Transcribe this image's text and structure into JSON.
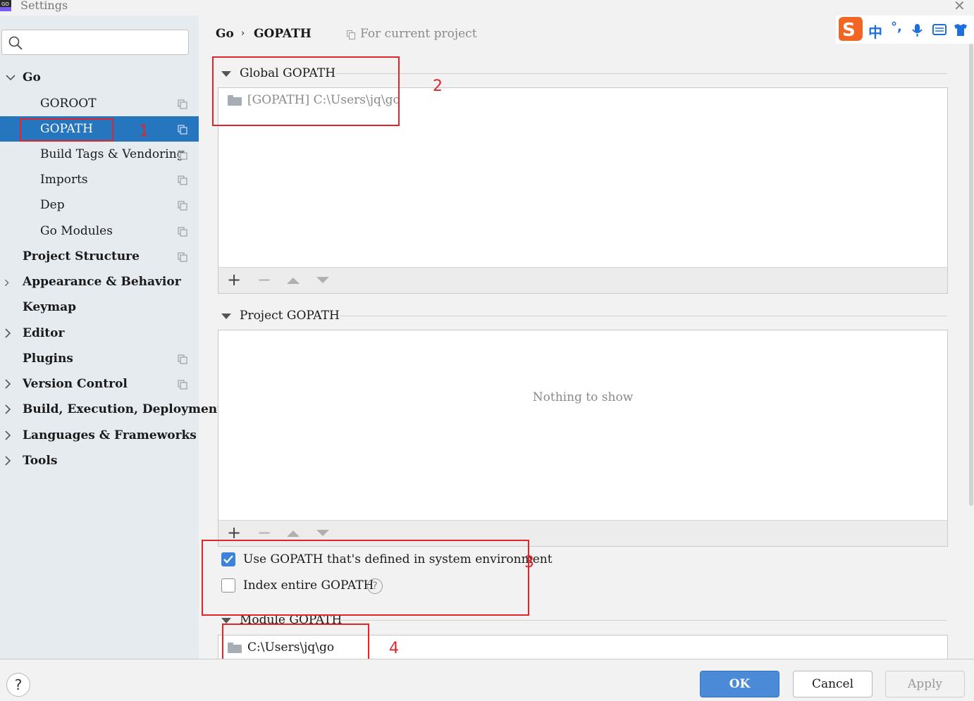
{
  "window": {
    "title": "Settings",
    "close_icon": "close-icon",
    "app_icon": "goland-app-icon"
  },
  "search": {
    "placeholder": "",
    "icon": "search-icon"
  },
  "sidebar": {
    "items": [
      {
        "label": "Go",
        "expanded": true
      },
      {
        "label": "GOROOT"
      },
      {
        "label": "GOPATH",
        "selected": true
      },
      {
        "label": "Build Tags & Vendoring"
      },
      {
        "label": "Imports"
      },
      {
        "label": "Dep"
      },
      {
        "label": "Go Modules"
      },
      {
        "label": "Project Structure"
      },
      {
        "label": "Appearance & Behavior",
        "expandable": true
      },
      {
        "label": "Keymap"
      },
      {
        "label": "Editor",
        "expandable": true
      },
      {
        "label": "Plugins"
      },
      {
        "label": "Version Control",
        "expandable": true
      },
      {
        "label": "Build, Execution, Deployment",
        "expandable": true
      },
      {
        "label": "Languages & Frameworks",
        "expandable": true
      },
      {
        "label": "Tools",
        "expandable": true
      }
    ]
  },
  "breadcrumb": {
    "parent": "Go",
    "separator": "›",
    "current": "GOPATH",
    "scope": "For current project"
  },
  "global_gopath": {
    "title": "Global GOPATH",
    "entries": [
      "[GOPATH] C:\\Users\\jq\\go"
    ]
  },
  "project_gopath": {
    "title": "Project GOPATH",
    "empty_text": "Nothing to show"
  },
  "toolbar": {
    "add": "+",
    "remove": "−"
  },
  "options": {
    "use_system_env": {
      "label": "Use GOPATH that's defined in system environment",
      "checked": true
    },
    "index_entire": {
      "label": "Index entire GOPATH",
      "checked": false,
      "help": "?"
    }
  },
  "module_gopath": {
    "title": "Module GOPATH",
    "entries": [
      "C:\\Users\\jq\\go"
    ]
  },
  "annotations": [
    "1",
    "2",
    "3",
    "4"
  ],
  "ime": {
    "label": "中",
    "punct": "°,",
    "icons": [
      "sogou-logo-icon",
      "microphone-icon",
      "keyboard-icon",
      "shirt-icon"
    ]
  },
  "footer": {
    "help": "?",
    "ok": "OK",
    "cancel": "Cancel",
    "apply": "Apply"
  },
  "colors": {
    "selection": "#2675bf",
    "annotation": "#e0262a",
    "ok_button": "#4a8ad6",
    "sidebar_bg": "#e6ebf0"
  }
}
